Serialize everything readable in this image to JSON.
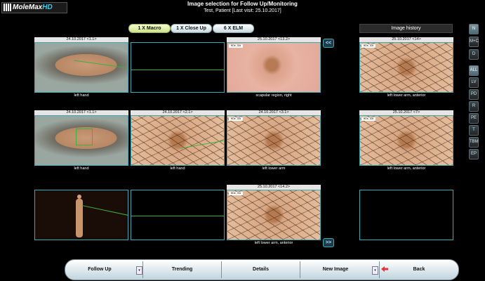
{
  "app": {
    "logo_text": "MoleMax",
    "logo_hd": "HD",
    "title": "Image selection for Follow Up/Monitoring",
    "subtitle": "Test, Patient [Last visit: 25.10.2017]"
  },
  "mode_tabs": [
    {
      "label": "1 X Macro",
      "active": true
    },
    {
      "label": "1 X Close Up",
      "active": false
    },
    {
      "label": "6 X ELM",
      "active": false
    }
  ],
  "history": {
    "title": "Image history"
  },
  "nav": {
    "prev": "<<",
    "next": ">>"
  },
  "rows": [
    {
      "macro": {
        "caption": "24.10.2017 <1.1>",
        "label": "left hand"
      },
      "closeup": {
        "caption": "",
        "label": ""
      },
      "elm": {
        "caption": "25.10.2017 <13.2>",
        "label": "scapular region, right",
        "badge": "HDe, 30x"
      },
      "history": {
        "caption": "25.10.2017 <14>",
        "label": "left lower arm, anterior",
        "badge": "HDe, 30x"
      }
    },
    {
      "macro": {
        "caption": "24.10.2017 <1.1>",
        "label": "left hand"
      },
      "closeup": {
        "caption": "24.10.2017 <2.1>",
        "label": "left hand"
      },
      "elm": {
        "caption": "24.10.2017 <3.1>",
        "label": "left lower arm",
        "badge": "HDe, 30x"
      },
      "history": {
        "caption": "25.10.2017 <7>",
        "label": "left lower arm, anterior",
        "badge": "HDe, 30x"
      }
    },
    {
      "macro": {
        "caption": "",
        "label": ""
      },
      "closeup": {
        "caption": "",
        "label": ""
      },
      "elm": {
        "caption": "25.10.2017 <14.2>",
        "label": "left lower arm, anterior",
        "badge": "HDe, 30x"
      },
      "history": {
        "caption": "",
        "label": ""
      }
    }
  ],
  "sidebar": {
    "top": [
      "N",
      "M+C",
      "D"
    ],
    "filters": [
      "ALL",
      "LV",
      "PD",
      "R",
      "PE",
      "T",
      "TBM",
      "EP"
    ],
    "active_top": "N",
    "active_filter": "ALL"
  },
  "bottom": {
    "follow_up": "Follow Up",
    "trending": "Trending",
    "details": "Details",
    "new_image": "New Image",
    "back": "Back",
    "drop_glyph": "▾"
  }
}
